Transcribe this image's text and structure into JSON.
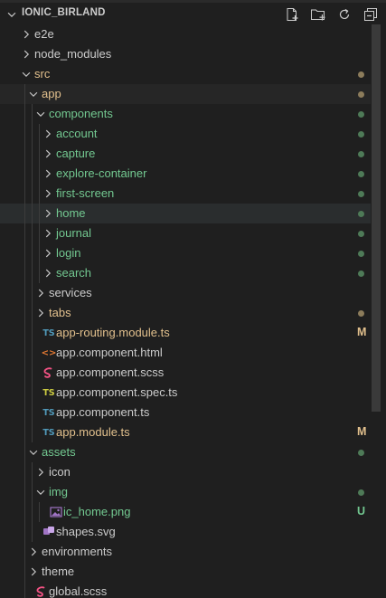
{
  "explorer": {
    "title": "IONIC_BIRLAND",
    "actions": [
      {
        "name": "new-file-icon"
      },
      {
        "name": "new-folder-icon"
      },
      {
        "name": "refresh-icon"
      },
      {
        "name": "collapse-all-icon"
      }
    ],
    "colors": {
      "green": "#73c991",
      "modified": "#e2c08d",
      "olive": "#8c7c5b",
      "default": "#cccccc",
      "ts_blue": "#519aba",
      "ts_yellow": "#cbcb41",
      "html_orange": "#e37933",
      "scss_pink": "#f55385",
      "svg_purple": "#a074c4"
    },
    "rows": [
      {
        "label": "e2e",
        "depth": 0,
        "kind": "folder",
        "open": false,
        "color": "#cccccc"
      },
      {
        "label": "node_modules",
        "depth": 0,
        "kind": "folder",
        "open": false,
        "color": "#cccccc"
      },
      {
        "label": "src",
        "depth": 0,
        "kind": "folder",
        "open": true,
        "color": "#e2c08d",
        "status": "dot",
        "status_color": "#8c7c5b"
      },
      {
        "label": "app",
        "depth": 1,
        "kind": "folder",
        "open": true,
        "color": "#e2c08d",
        "status": "dot",
        "status_color": "#8c7c5b",
        "highlight": "active"
      },
      {
        "label": "components",
        "depth": 2,
        "kind": "folder",
        "open": true,
        "color": "#73c991",
        "status": "dot",
        "status_color": "#4e7a57"
      },
      {
        "label": "account",
        "depth": 3,
        "kind": "folder",
        "open": false,
        "color": "#73c991",
        "status": "dot",
        "status_color": "#4e7a57"
      },
      {
        "label": "capture",
        "depth": 3,
        "kind": "folder",
        "open": false,
        "color": "#73c991",
        "status": "dot",
        "status_color": "#4e7a57"
      },
      {
        "label": "explore-container",
        "depth": 3,
        "kind": "folder",
        "open": false,
        "color": "#73c991",
        "status": "dot",
        "status_color": "#4e7a57"
      },
      {
        "label": "first-screen",
        "depth": 3,
        "kind": "folder",
        "open": false,
        "color": "#73c991",
        "status": "dot",
        "status_color": "#4e7a57"
      },
      {
        "label": "home",
        "depth": 3,
        "kind": "folder",
        "open": false,
        "color": "#73c991",
        "status": "dot",
        "status_color": "#4e7a57",
        "highlight": "selected"
      },
      {
        "label": "journal",
        "depth": 3,
        "kind": "folder",
        "open": false,
        "color": "#73c991",
        "status": "dot",
        "status_color": "#4e7a57"
      },
      {
        "label": "login",
        "depth": 3,
        "kind": "folder",
        "open": false,
        "color": "#73c991",
        "status": "dot",
        "status_color": "#4e7a57"
      },
      {
        "label": "search",
        "depth": 3,
        "kind": "folder",
        "open": false,
        "color": "#73c991",
        "status": "dot",
        "status_color": "#4e7a57"
      },
      {
        "label": "services",
        "depth": 2,
        "kind": "folder",
        "open": false,
        "color": "#cccccc"
      },
      {
        "label": "tabs",
        "depth": 2,
        "kind": "folder",
        "open": false,
        "color": "#e2c08d",
        "status": "dot",
        "status_color": "#8c7c5b"
      },
      {
        "label": "app-routing.module.ts",
        "depth": 2,
        "kind": "file",
        "icon_text": "TS",
        "icon_color": "#519aba",
        "color": "#e2c08d",
        "status": "letter",
        "status_text": "M",
        "status_color": "#e2c08d"
      },
      {
        "label": "app.component.html",
        "depth": 2,
        "kind": "file",
        "icon_text": "<>",
        "icon_color": "#e37933",
        "color": "#cccccc"
      },
      {
        "label": "app.component.scss",
        "depth": 2,
        "kind": "file",
        "icon_text": "scss",
        "icon_color": "#f55385",
        "color": "#cccccc"
      },
      {
        "label": "app.component.spec.ts",
        "depth": 2,
        "kind": "file",
        "icon_text": "TS",
        "icon_color": "#cbcb41",
        "color": "#cccccc"
      },
      {
        "label": "app.component.ts",
        "depth": 2,
        "kind": "file",
        "icon_text": "TS",
        "icon_color": "#519aba",
        "color": "#cccccc"
      },
      {
        "label": "app.module.ts",
        "depth": 2,
        "kind": "file",
        "icon_text": "TS",
        "icon_color": "#519aba",
        "color": "#e2c08d",
        "status": "letter",
        "status_text": "M",
        "status_color": "#e2c08d"
      },
      {
        "label": "assets",
        "depth": 1,
        "kind": "folder",
        "open": true,
        "color": "#73c991",
        "status": "dot",
        "status_color": "#4e7a57"
      },
      {
        "label": "icon",
        "depth": 2,
        "kind": "folder",
        "open": false,
        "color": "#cccccc"
      },
      {
        "label": "img",
        "depth": 2,
        "kind": "folder",
        "open": true,
        "color": "#73c991",
        "status": "dot",
        "status_color": "#4e7a57"
      },
      {
        "label": "ic_home.png",
        "depth": 3,
        "kind": "file",
        "icon_text": "img",
        "icon_color": "#a074c4",
        "color": "#73c991",
        "status": "letter",
        "status_text": "U",
        "status_color": "#73c991"
      },
      {
        "label": "shapes.svg",
        "depth": 2,
        "kind": "file",
        "icon_text": "svg",
        "icon_color": "#a074c4",
        "color": "#cccccc"
      },
      {
        "label": "environments",
        "depth": 1,
        "kind": "folder",
        "open": false,
        "color": "#cccccc"
      },
      {
        "label": "theme",
        "depth": 1,
        "kind": "folder",
        "open": false,
        "color": "#cccccc"
      },
      {
        "label": "global.scss",
        "depth": 1,
        "kind": "file",
        "icon_text": "scss",
        "icon_color": "#f55385",
        "color": "#cccccc"
      }
    ]
  }
}
